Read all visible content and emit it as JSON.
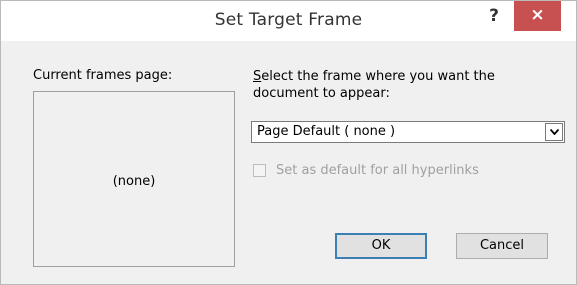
{
  "dialog": {
    "title": "Set Target Frame",
    "help_label": "?",
    "close_label": "×"
  },
  "frames_panel": {
    "label": "Current frames page:",
    "content": "(none)"
  },
  "select_frame": {
    "label_underlined": "S",
    "label_rest": "elect the frame where you want the document to appear:",
    "value": "Page Default ( none )"
  },
  "checkbox": {
    "label": "Set as default for all hyperlinks",
    "checked": false,
    "enabled": false
  },
  "buttons": {
    "ok_label": "OK",
    "cancel_label": "Cancel"
  }
}
